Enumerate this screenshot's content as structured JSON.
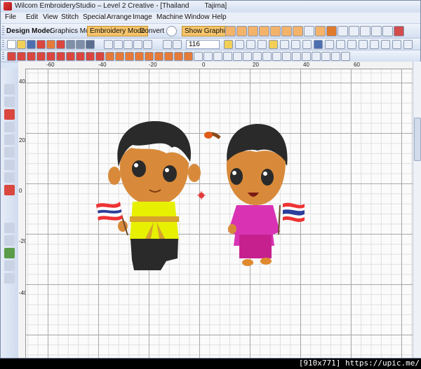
{
  "window": {
    "title": "Wilcom EmbroideryStudio – Level 2 Creative - [Thailand        Tajima]"
  },
  "menu": [
    "File",
    "Edit",
    "View",
    "Stitch",
    "Special",
    "Arrange",
    "Image",
    "Machine",
    "Window",
    "Help"
  ],
  "toolbar": {
    "design_mode_label": "Design Mode:",
    "graphics_mode": "Graphics Mode",
    "embroidery_mode": "Embroidery Mode",
    "convert": "Convert",
    "show_graphics": "Show Graphics",
    "zoom_value": "116"
  },
  "ruler": {
    "top": [
      "-60",
      "-40",
      "-20",
      "0",
      "20",
      "40",
      "60"
    ],
    "left": [
      "40",
      "20",
      "0",
      "-20",
      "-40"
    ]
  },
  "watermark": "[910x771] https://upic.me/",
  "colors": {
    "accent": "#f6c56b",
    "titlebar": "#d3deef"
  }
}
